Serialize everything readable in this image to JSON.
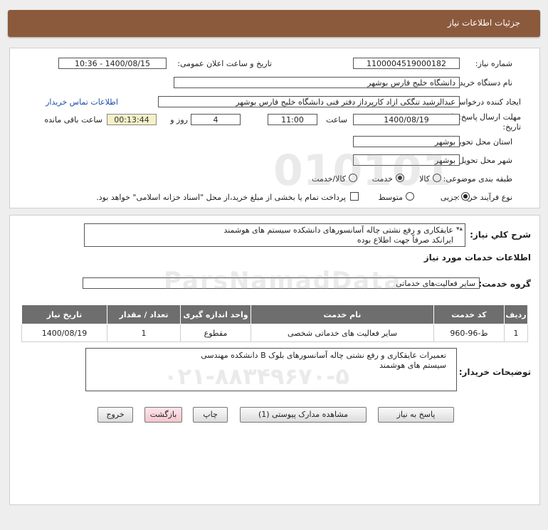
{
  "header": {
    "title": "جزئیات اطلاعات نیاز"
  },
  "info": {
    "need_number_label": "شماره نیاز:",
    "need_number": "1100004519000182",
    "announce_label": "تاریخ و ساعت اعلان عمومی:",
    "announce_value": "1400/08/15 - 10:36",
    "buyer_org_label": "نام دستگاه خریدار:",
    "buyer_org": "دانشگاه خلیج فارس بوشهر",
    "creator_label": "ایجاد کننده درخواست:",
    "creator": "عبدالرشید تنگکی ازاد کارپرداز دفتر فنی دانشگاه خلیج فارس بوشهر",
    "contact_link": "اطلاعات تماس خریدار",
    "deadline_label_1": "مهلت ارسال پاسخ: تا",
    "deadline_label_2": "تاریخ:",
    "deadline_date": "1400/08/19",
    "time_label": "ساعت",
    "deadline_time": "11:00",
    "days_value": "4",
    "days_label": "روز و",
    "remaining_time": "00:13:44",
    "remaining_label": "ساعت باقی مانده",
    "province_label": "استان محل تحویل:",
    "province": "بوشهر",
    "city_label": "شهر محل تحویل:",
    "city": "بوشهر",
    "category_label": "طبقه بندی موضوعی:",
    "category_options": [
      "کالا",
      "خدمت",
      "کالا/خدمت"
    ],
    "category_selected": "خدمت",
    "process_label": "نوع فرآیند خرید :",
    "process_options": [
      "جزیی",
      "متوسط"
    ],
    "process_selected": "جزیی",
    "payment_note": "پرداخت تمام یا بخشی از مبلغ خرید،از محل \"اسناد خزانه اسلامی\" خواهد بود."
  },
  "details": {
    "summary_label": "شرح کلي نياز:",
    "summary_line1": "عایقکاری و رفع نشتی چاله آسانسورهای دانشکده سیستم های هوشمند",
    "summary_line2": "ایرانکد صرفاً جهت اطلاع بوده",
    "services_heading": "اطلاعات خدمات مورد نیاز",
    "group_label": "گروه خدمت:",
    "group_value": "سایر فعالیت‌های خدماتی",
    "table": {
      "headers": [
        "ردیف",
        "کد خدمت",
        "نام خدمت",
        "واحد اندازه گیری",
        "تعداد / مقدار",
        "تاریخ نیاز"
      ],
      "rows": [
        [
          "1",
          "ط-96-960",
          "سایر فعالیت های خدماتی شخصی",
          "مقطوع",
          "1",
          "1400/08/19"
        ]
      ]
    },
    "buyer_notes_label": "توضیحات خریدار:",
    "buyer_notes": "تعمیرات عایقکاری و رفع نشتی چاله آسانسورهای بلوک B دانشکده مهندسی سیستم های هوشمند"
  },
  "buttons": {
    "reply": "پاسخ به نیاز",
    "attachments": "مشاهده مدارک پیوستی (1)",
    "print": "چاپ",
    "back": "بازگشت",
    "exit": "خروج"
  }
}
